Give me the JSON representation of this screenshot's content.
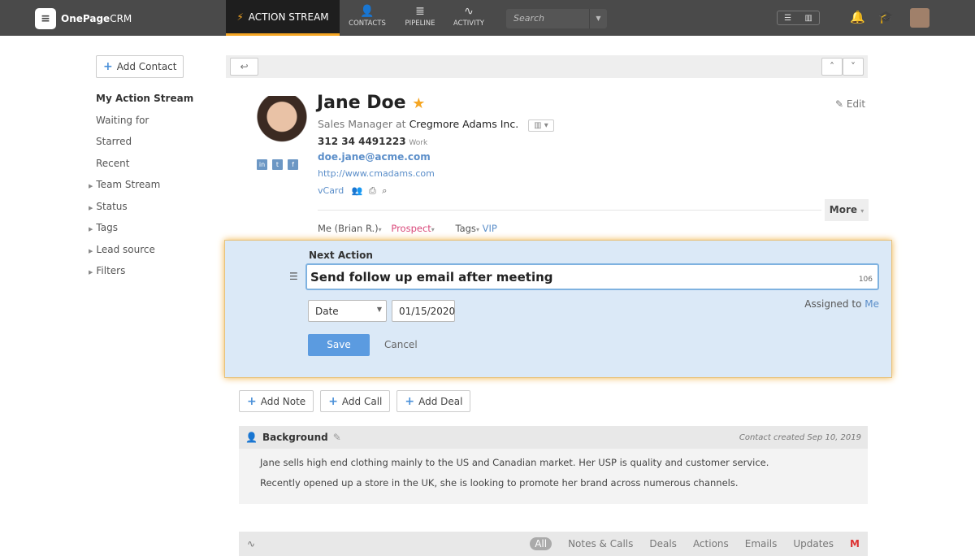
{
  "topbar": {
    "brand_bold": "OnePage",
    "brand_light": "CRM",
    "action_stream": "ACTION STREAM",
    "nav": [
      "CONTACTS",
      "PIPELINE",
      "ACTIVITY"
    ],
    "search_placeholder": "Search"
  },
  "sidebar": {
    "add_contact": "Add Contact",
    "items": [
      {
        "label": "My Action Stream",
        "expand": false
      },
      {
        "label": "Waiting for",
        "expand": false
      },
      {
        "label": "Starred",
        "expand": false
      },
      {
        "label": "Recent",
        "expand": false
      },
      {
        "label": "Team Stream",
        "expand": true
      },
      {
        "label": "Status",
        "expand": true
      },
      {
        "label": "Tags",
        "expand": true
      },
      {
        "label": "Lead source",
        "expand": true
      },
      {
        "label": "Filters",
        "expand": true
      }
    ]
  },
  "contact": {
    "name": "Jane Doe",
    "title": "Sales Manager at",
    "company": "Cregmore Adams Inc.",
    "phone": "312 34 4491223",
    "phone_type": "Work",
    "email": "doe.jane@acme.com",
    "website": "http://www.cmadams.com",
    "vcard": "vCard",
    "edit": "Edit",
    "more": "More",
    "owner": "Me (Brian R.)",
    "status": "Prospect",
    "tags_label": "Tags",
    "tag": "VIP",
    "status_color": "#d9487a"
  },
  "next_action": {
    "label": "Next Action",
    "value": "Send follow up email after meeting",
    "count": "106",
    "date_type": "Date",
    "date": "01/15/2020",
    "assigned_label": "Assigned to",
    "assigned_to": "Me",
    "save": "Save",
    "cancel": "Cancel"
  },
  "actions": [
    "Add Note",
    "Add Call",
    "Add Deal"
  ],
  "background": {
    "title": "Background",
    "created": "Contact created Sep 10, 2019",
    "paragraphs": [
      "Jane sells high end clothing mainly to the US and Canadian market. Her USP is quality and customer service.",
      "Recently opened up a store in the UK, she is looking to promote her brand across numerous channels."
    ]
  },
  "feed": {
    "filters": [
      "All",
      "Notes & Calls",
      "Deals",
      "Actions",
      "Emails",
      "Updates"
    ]
  }
}
